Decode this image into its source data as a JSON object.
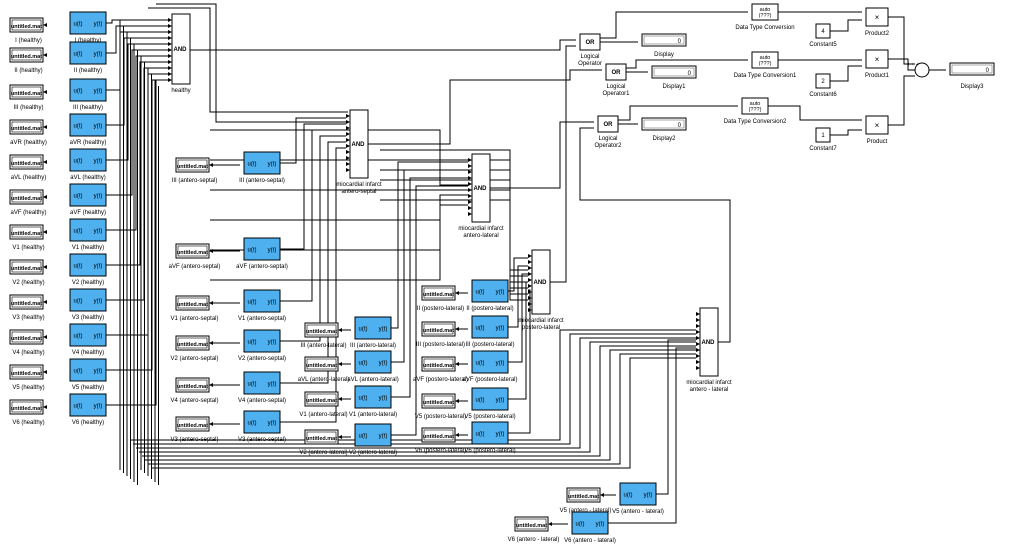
{
  "colors": {
    "background": "#ffffff",
    "line": "#000000",
    "block_fill": "#ffffff",
    "lookup_fill": "#4fb0f0",
    "display_bg": "#ffffff"
  },
  "from_file_text": "untitled.mat",
  "port_in": "u(t)",
  "port_out": "y(t)",
  "and_op": "AND",
  "or_op": "OR",
  "product_op": "×",
  "dtc_text": [
    "auto",
    "(???)"
  ],
  "healthy": {
    "from_captions": [
      "I (healthy)",
      "II (healthy)",
      "III (healthy)",
      "aVR (healthy)",
      "aVL (healthy)",
      "aVF (healthy)",
      "V1 (healthy)",
      "V2 (healthy)",
      "V3 (healthy)",
      "V4 (healthy)",
      "V5 (healthy)",
      "V6 (healthy)"
    ],
    "lookup_captions": [
      "I (healthy)",
      "II (healthy)",
      "III (healthy)",
      "aVR (healthy)",
      "aVL (healthy)",
      "aVF (healthy)",
      "V1 (healthy)",
      "V2 (healthy)",
      "V3 (healthy)",
      "V4 (healthy)",
      "V5 (healthy)",
      "V6 (healthy)"
    ],
    "and_caption": "healthy"
  },
  "antero_septal": {
    "from_captions": [
      "III (antero-septal)",
      "aVF (antero-septal)",
      "V1 (antero-septal)",
      "V2 (antero-septal)",
      "V4 (antero-septal)",
      "V3 (antero-septal)"
    ],
    "lookup_captions": [
      "III (antero-septal)",
      "aVF (antero-septal)",
      "V1 (antero-septal)",
      "V2 (antero-septal)",
      "V4 (antero-septal)",
      "V3 (antero-septal)"
    ],
    "and_caption": [
      "miocardial infarct",
      "antero-septal"
    ]
  },
  "antero_lateral": {
    "from_captions": [
      "III (antero-lateral)",
      "aVL (antero-lateral)",
      "V1 (antero-lateral)",
      "V2 (antero-lateral)"
    ],
    "lookup_captions": [
      "III (antero-lateral)",
      "aVL (antero-lateral)",
      "V1 (antero-lateral)",
      "V2 (antero-lateral)"
    ],
    "and_caption": [
      "miocardial infarct",
      "antero-lateral"
    ]
  },
  "postero_lateral": {
    "from_captions": [
      "II (postero-lateral)",
      "III (postero-lateral)",
      "aVF (postero-lateral)",
      "V5 (postero-lateral)",
      "V6 (postero-lateral)"
    ],
    "lookup_captions": [
      "II (postero-lateral)",
      "III (postero-lateral)",
      "aVF (postero-lateral)",
      "V5 (postero-lateral)",
      "V6 (postero-lateral)"
    ],
    "and_caption": [
      "miocardial infarct",
      "postero-lateral"
    ]
  },
  "antero_lateral_2": {
    "from_captions": [
      "V5 (antero - lateral)",
      "V6 (antero - lateral)"
    ],
    "lookup_captions": [
      "V5 (antero - lateral)",
      "V6 (antero - lateral)"
    ],
    "and_caption": [
      "miocardial infarct",
      "antero - lateral"
    ]
  },
  "logic": {
    "or_captions": [
      [
        "Logical",
        "Operator"
      ],
      [
        "Logical",
        "Operator1"
      ],
      [
        "Logical",
        "Operator2"
      ]
    ],
    "display_values": [
      "0",
      "0",
      "0"
    ],
    "display_captions": [
      "Display",
      "Display1",
      "Display2"
    ],
    "dtc_captions": [
      "Data Type Conversion",
      "Data Type Conversion1",
      "Data Type Conversion2"
    ],
    "constants": [
      {
        "value": "4",
        "caption": "Constant5"
      },
      {
        "value": "2",
        "caption": "Constant6"
      },
      {
        "value": "1",
        "caption": "Constant7"
      }
    ],
    "product_captions": [
      "Product2",
      "Product1",
      "Product"
    ],
    "sum_signs": "+\n+\n+",
    "final_display_value": "0",
    "final_display_caption": "Display3"
  }
}
